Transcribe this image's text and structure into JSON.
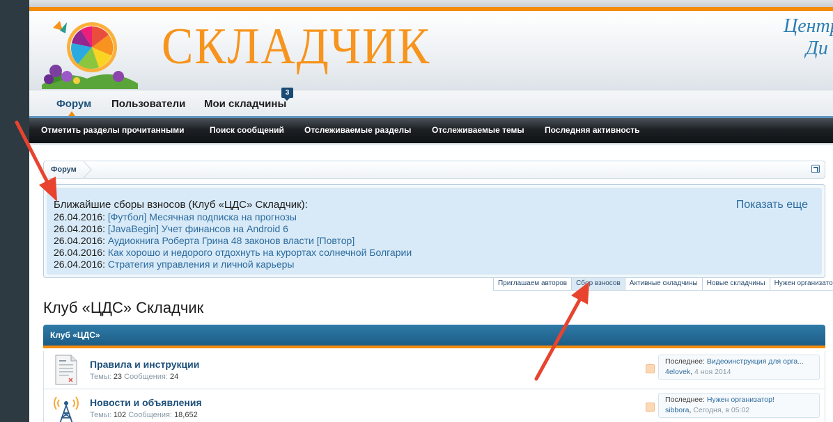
{
  "header": {
    "logo_text": "СКЛАДЧИК",
    "center_line1": "Центр",
    "center_line2": "Ди"
  },
  "main_nav": {
    "forum": "Форум",
    "users": "Пользователи",
    "mine": "Мои складчины",
    "mine_badge": "3"
  },
  "sub_nav": [
    "Отметить разделы прочитанными",
    "Поиск сообщений",
    "Отслеживаемые разделы",
    "Отслеживаемые темы",
    "Последняя активность"
  ],
  "breadcrumb": {
    "forum": "Форум"
  },
  "notice": {
    "title": "Ближайшие сборы взносов (Клуб «ЦДС» Складчик):",
    "more": "Показать еще",
    "items": [
      {
        "date": "26.04.2016:",
        "link": "[Футбол] Месячная подписка на прогнозы"
      },
      {
        "date": "26.04.2016:",
        "link": "[JavaBegin] Учет финансов на Android 6"
      },
      {
        "date": "26.04.2016:",
        "link": "Аудиокнига Роберта Грина 48 законов власти [Повтор]"
      },
      {
        "date": "26.04.2016:",
        "link": "Как хорошо и недорого отдохнуть на курортах солнечной Болгарии"
      },
      {
        "date": "26.04.2016:",
        "link": "Стратегия управления и личной карьеры"
      }
    ],
    "tabs": [
      "Приглашаем авторов",
      "Сбор взносов",
      "Активные складчины",
      "Новые складчины",
      "Нужен организатор"
    ]
  },
  "club": {
    "title": "Клуб «ЦДС» Складчик",
    "category": "Клуб «ЦДС»",
    "forums": [
      {
        "name": "Правила и инструкции",
        "threads_label": "Темы:",
        "threads": "23",
        "posts_label": "Сообщения:",
        "posts": "24",
        "last_label": "Последнее:",
        "last_title": "Видеоинструкция для орга...",
        "last_user": "4elovek",
        "last_date": "4 ноя 2014"
      },
      {
        "name": "Новости и объявления",
        "threads_label": "Темы:",
        "threads": "102",
        "posts_label": "Сообщения:",
        "posts": "18,652",
        "last_label": "Последнее:",
        "last_title": "Нужен организатор!",
        "last_user": "sibbora",
        "last_date": "Сегодня, в 05:02"
      }
    ]
  },
  "colors": {
    "accent_orange": "#f58c08",
    "link_blue": "#2b6a9e",
    "arrow_red": "#e8432f"
  }
}
